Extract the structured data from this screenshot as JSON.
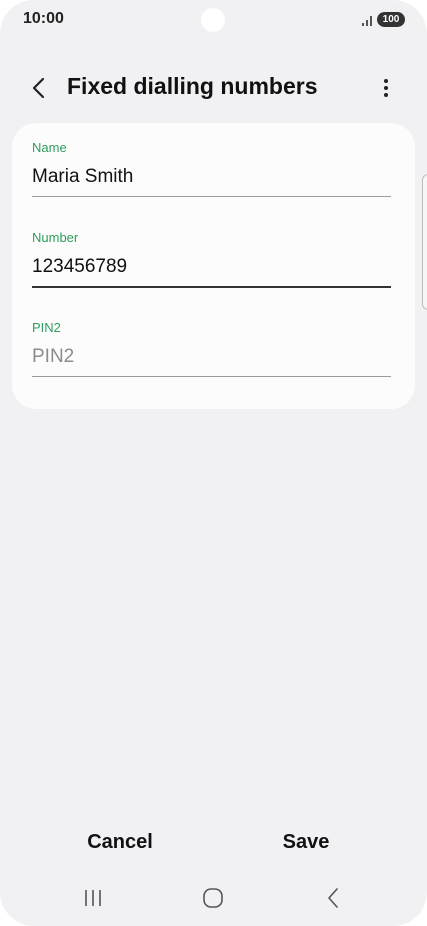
{
  "status_bar": {
    "time": "10:00",
    "battery": "100"
  },
  "header": {
    "title": "Fixed dialling numbers"
  },
  "form": {
    "name": {
      "label": "Name",
      "value": "Maria Smith"
    },
    "number": {
      "label": "Number",
      "value": "123456789"
    },
    "pin2": {
      "label": "PIN2",
      "placeholder": "PIN2"
    }
  },
  "actions": {
    "cancel_label": "Cancel",
    "save_label": "Save"
  },
  "icons": {
    "back": "chevron-left-icon",
    "more": "more-vertical-icon",
    "recents": "recents-icon",
    "home": "home-icon",
    "nav_back": "nav-back-icon"
  },
  "colors": {
    "accent_label": "#2e9e5c",
    "background": "#f1f1f3",
    "card": "#fcfcfd"
  }
}
